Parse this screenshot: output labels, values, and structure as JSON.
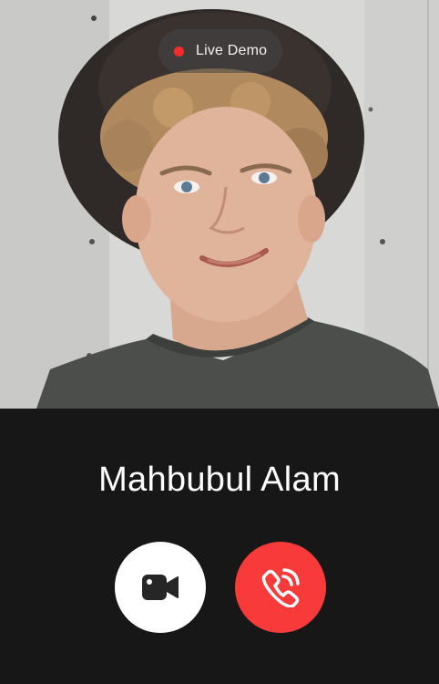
{
  "status": {
    "label": "Live Demo",
    "indicator_color": "#ff2b2b"
  },
  "caller": {
    "name": "Mahbubul Alam",
    "photo": "caller-photo"
  },
  "actions": {
    "video": {
      "icon": "video-camera-icon",
      "color": "#ffffff"
    },
    "end_call": {
      "icon": "phone-ringing-icon",
      "color": "#f83a3a"
    }
  }
}
